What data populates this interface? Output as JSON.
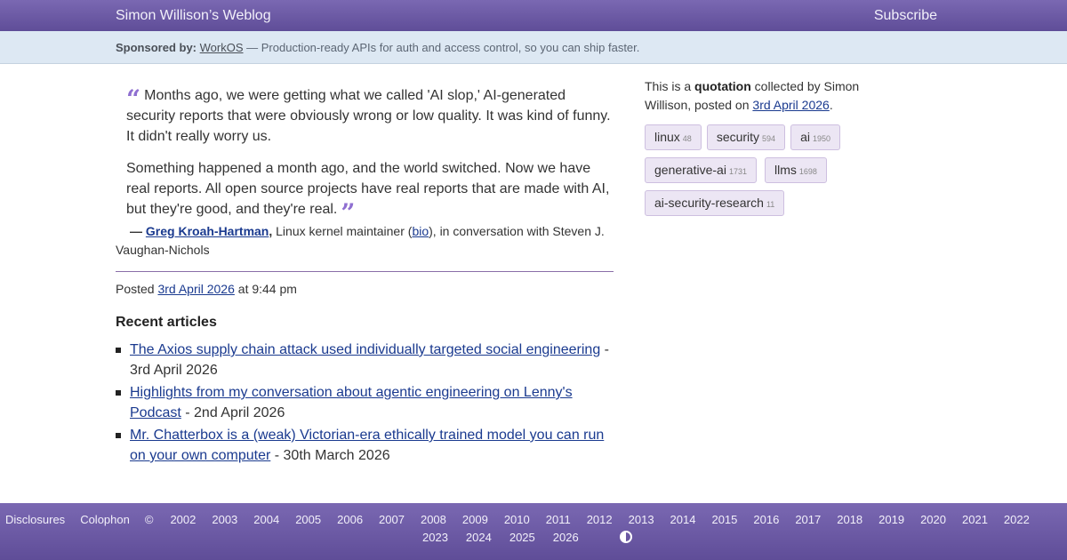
{
  "header": {
    "site_title": "Simon Willison’s Weblog",
    "subscribe": "Subscribe"
  },
  "sponsor": {
    "label": "Sponsored by:",
    "name": "WorkOS",
    "text": " — Production-ready APIs for auth and access control, so you can ship faster."
  },
  "quote": {
    "open_mark": "“",
    "close_mark": "”",
    "paragraphs": [
      "Months ago, we were getting what we called 'AI slop,' AI-generated security reports that were obviously wrong or low quality. It was kind of funny. It didn't really worry us.",
      "Something happened a month ago, and the world switched. Now we have real reports. All open source projects have real reports that are made with AI, but they're good, and they're real."
    ],
    "cite_dash": "—",
    "cite_name": "Greg Kroah-Hartman",
    "cite_comma": ",",
    "cite_role_pre": " Linux kernel maintainer (",
    "cite_bio": "bio",
    "cite_role_post": "), in conversation with Steven J. Vaughan-Nichols"
  },
  "posted": {
    "prefix": "Posted ",
    "date": "3rd April 2026",
    "suffix": " at 9:44 pm"
  },
  "recent": {
    "heading": "Recent articles",
    "items": [
      {
        "title": "The Axios supply chain attack used individually targeted social engineering",
        "date": " - 3rd April 2026"
      },
      {
        "title": "Highlights from my conversation about agentic engineering on Lenny's Podcast",
        "date": " - 2nd April 2026"
      },
      {
        "title": "Mr. Chatterbox is a (weak) Victorian-era ethically trained model you can run on your own computer",
        "date": " - 30th March 2026"
      }
    ]
  },
  "sidebar": {
    "intro_pre": "This is a ",
    "intro_strong": "quotation",
    "intro_mid": " collected by Simon Willison, posted on ",
    "intro_date": "3rd April 2026",
    "intro_end": ".",
    "tags": [
      {
        "name": "linux",
        "count": "48"
      },
      {
        "name": "security",
        "count": "594"
      },
      {
        "name": "ai",
        "count": "1950"
      },
      {
        "name": "generative-ai",
        "count": "1731"
      },
      {
        "name": "llms",
        "count": "1698"
      },
      {
        "name": "ai-security-research",
        "count": "11"
      }
    ]
  },
  "footer": {
    "disclosures": "Disclosures",
    "colophon": "Colophon",
    "copyright": "©",
    "years_line1": [
      "2002",
      "2003",
      "2004",
      "2005",
      "2006",
      "2007",
      "2008",
      "2009",
      "2010",
      "2011",
      "2012",
      "2013",
      "2014",
      "2015",
      "2016",
      "2017",
      "2018",
      "2019",
      "2020",
      "2021",
      "2022"
    ],
    "years_line2": [
      "2023",
      "2024",
      "2025",
      "2026"
    ],
    "theme_icon": "contrast-icon"
  },
  "colors": {
    "header_bg": "#6d5ba6",
    "sponsor_bg": "#dde8f3",
    "link": "#1a3a8f",
    "quote_mark": "#8f6fd1",
    "tag_bg": "#ece6f4"
  }
}
